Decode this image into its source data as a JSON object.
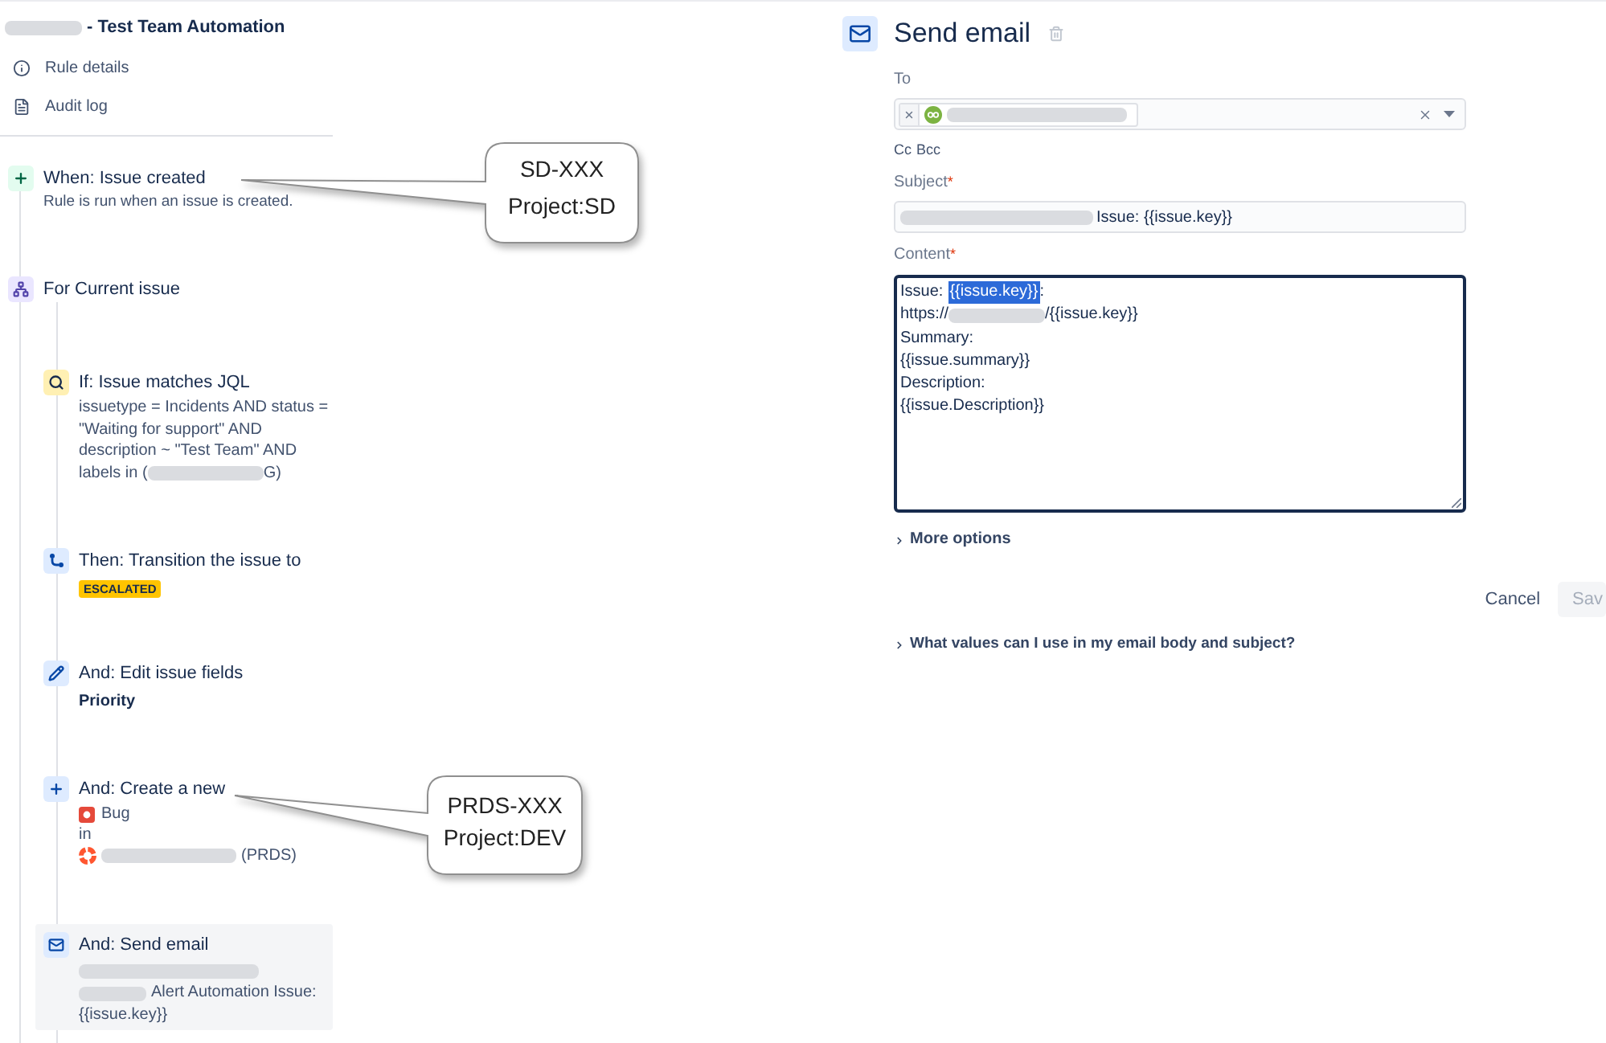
{
  "rule": {
    "title": [
      {
        "kind": "blur"
      },
      {
        "kind": "text",
        "text": "- Test Team Automation"
      }
    ],
    "nav": [
      {
        "kind": "details",
        "label": "Rule details"
      },
      {
        "kind": "log",
        "label": "Audit log"
      }
    ]
  },
  "flow": {
    "trigger": {
      "title": "When: Issue created",
      "description": "Rule is run when an issue is created."
    },
    "branch": {
      "title": "For Current issue"
    },
    "steps": [
      {
        "kind": "condition",
        "selected": false,
        "title": "If: Issue matches JQL",
        "lines": [
          {
            "segments": [
              {
                "kind": "text",
                "text": "issuetype = Incidents AND status ="
              }
            ]
          },
          {
            "segments": [
              {
                "kind": "text",
                "text": "\"Waiting for support\" AND"
              }
            ]
          },
          {
            "segments": [
              {
                "kind": "text",
                "text": "description ~ \"Test Team\" AND"
              }
            ]
          },
          {
            "segments": [
              {
                "kind": "text",
                "text": "labels in ("
              },
              {
                "kind": "blur"
              },
              {
                "kind": "text",
                "text": "G)"
              }
            ]
          }
        ]
      },
      {
        "kind": "transition",
        "selected": false,
        "title": "Then: Transition the issue to",
        "status": "ESCALATED"
      },
      {
        "kind": "edit",
        "selected": false,
        "title": "And: Edit issue fields",
        "field": "Priority"
      },
      {
        "kind": "create",
        "selected": false,
        "title": "And: Create a new",
        "issue_type": "Bug",
        "joiner": "in",
        "project": [
          {
            "kind": "blur"
          },
          {
            "kind": "text",
            "text": "(PRDS)"
          }
        ]
      },
      {
        "kind": "email",
        "selected": true,
        "title": "And: Send email",
        "lines": [
          {
            "segments": [
              {
                "kind": "blur"
              }
            ]
          },
          {
            "segments": [
              {
                "kind": "blur"
              },
              {
                "kind": "text",
                "text": "Alert Automation Issue:"
              }
            ]
          },
          {
            "segments": [
              {
                "kind": "text",
                "text": "{{issue.key}}"
              }
            ]
          }
        ]
      }
    ]
  },
  "callouts": [
    {
      "lines": [
        "SD-XXX",
        "Project:SD"
      ]
    },
    {
      "lines": [
        "PRDS-XXX",
        "Project:DEV"
      ]
    }
  ],
  "editor": {
    "title": "Send email",
    "to": {
      "label": "To",
      "chips": [
        {
          "segments": [
            {
              "kind": "blur"
            }
          ]
        }
      ]
    },
    "cc_links": [
      "Cc",
      "Bcc"
    ],
    "subject": {
      "label": "Subject",
      "required_mark": "*",
      "value": [
        {
          "kind": "blur"
        },
        {
          "kind": "text",
          "text": "Issue: {{issue.key}}"
        }
      ]
    },
    "content": {
      "label": "Content",
      "required_mark": "*",
      "focused": true,
      "lines": [
        {
          "segments": [
            {
              "kind": "text",
              "text": "Issue:",
              "selected": false
            },
            {
              "kind": "text",
              "text": "{{issue.key}}",
              "selected": true
            },
            {
              "kind": "text",
              "text": ":",
              "selected": false
            }
          ]
        },
        {
          "segments": [
            {
              "kind": "text",
              "text": "https://",
              "selected": false
            },
            {
              "kind": "blur",
              "selected": false
            },
            {
              "kind": "text",
              "text": "/{{issue.key}}",
              "selected": false
            }
          ]
        },
        {
          "segments": [
            {
              "kind": "text",
              "text": "Summary:",
              "selected": false
            }
          ]
        },
        {
          "segments": [
            {
              "kind": "text",
              "text": "{{issue.summary}}",
              "selected": false
            }
          ]
        },
        {
          "segments": [
            {
              "kind": "text",
              "text": "Description:",
              "selected": false
            }
          ]
        },
        {
          "segments": [
            {
              "kind": "text",
              "text": "{{issue.Description}}",
              "selected": false
            }
          ]
        }
      ]
    },
    "more_options": {
      "label": "More options",
      "expanded": false
    },
    "actions": [
      {
        "kind": "subtle",
        "label": "Cancel",
        "disabled": false
      },
      {
        "kind": "primary",
        "label": "Sav",
        "disabled": true
      }
    ],
    "help": {
      "label": "What values can I use in my email body and subject?",
      "expanded": false
    }
  }
}
